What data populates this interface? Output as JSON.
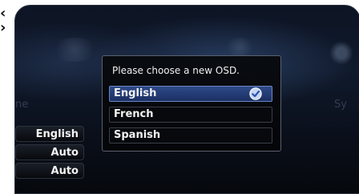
{
  "dialog": {
    "title": "Please choose a new OSD.",
    "options": [
      {
        "label": "English",
        "selected": true
      },
      {
        "label": "French",
        "selected": false
      },
      {
        "label": "Spanish",
        "selected": false
      }
    ]
  },
  "side_menu": {
    "items": [
      "English",
      "Auto",
      "Auto"
    ]
  },
  "background": {
    "left_text": "ne",
    "right_text": "Sy"
  },
  "colors": {
    "selection": "#2e4a88",
    "dialog_bg": "#07090d",
    "border": "#5a616d"
  }
}
